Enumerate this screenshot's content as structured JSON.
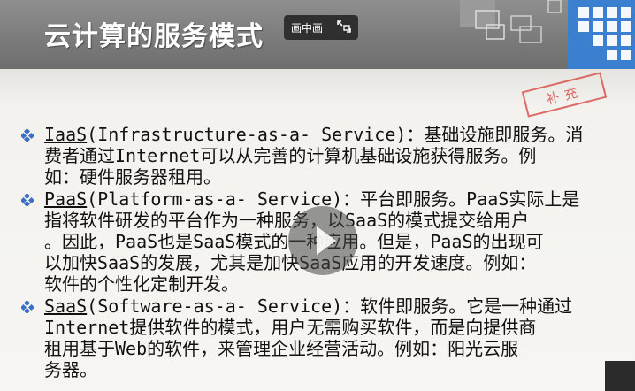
{
  "slide": {
    "title": "云计算的服务模式",
    "stamp": "补充",
    "items": [
      {
        "term": "IaaS",
        "text": "(Infrastructure-as-a- Service)：基础设施即服务。消\n费者通过Internet可以从完善的计算机基础设施获得服务。例\n如：硬件服务器租用。"
      },
      {
        "term": "PaaS",
        "text": "(Platform-as-a- Service)：平台即服务。PaaS实际上是\n指将软件研发的平台作为一种服务，以SaaS的模式提交给用户\n。因此，PaaS也是SaaS模式的一种应用。但是，PaaS的出现可\n以加快SaaS的发展，尤其是加快SaaS应用的开发速度。例如：\n软件的个性化定制开发。"
      },
      {
        "term": "SaaS",
        "text": "(Software-as-a- Service)：软件即服务。它是一种通过\nInternet提供软件的模式，用户无需购买软件，而是向提供商\n租用基于Web的软件，来管理企业经营活动。例如：阳光云服\n务器。"
      }
    ]
  },
  "player": {
    "pip_label": "画中画",
    "pip_icon": "pip-toggle-icon",
    "play_icon": "play-icon"
  },
  "colors": {
    "title_bar": "#7a7a7a",
    "bullet": "#3a6fc4",
    "stamp": "#d9534f"
  }
}
